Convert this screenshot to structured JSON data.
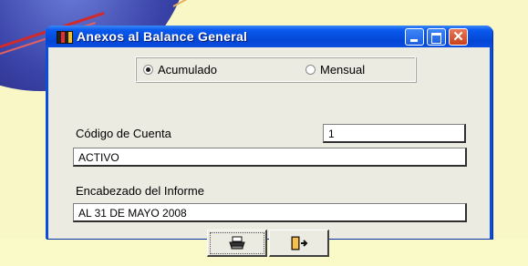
{
  "window": {
    "title": "Anexos al Balance General",
    "controls": [
      "minimize",
      "maximize",
      "close"
    ]
  },
  "period_options": [
    {
      "label": "Acumulado",
      "selected": true
    },
    {
      "label": "Mensual",
      "selected": false
    }
  ],
  "codigo_cuenta": {
    "label": "Código de Cuenta",
    "value": "1"
  },
  "cuenta_nombre": {
    "value": "ACTIVO"
  },
  "encabezado": {
    "label": "Encabezado del Informe",
    "value": "AL 31 DE MAYO 2008"
  },
  "actions": [
    {
      "name": "print-button",
      "icon": "printer-icon"
    },
    {
      "name": "exit-button",
      "icon": "exit-door-icon"
    }
  ],
  "colors": {
    "titlebar": "#0a4ee0",
    "client": "#ecebe1",
    "desktop": "#fbfbc4",
    "close": "#d9552f"
  }
}
